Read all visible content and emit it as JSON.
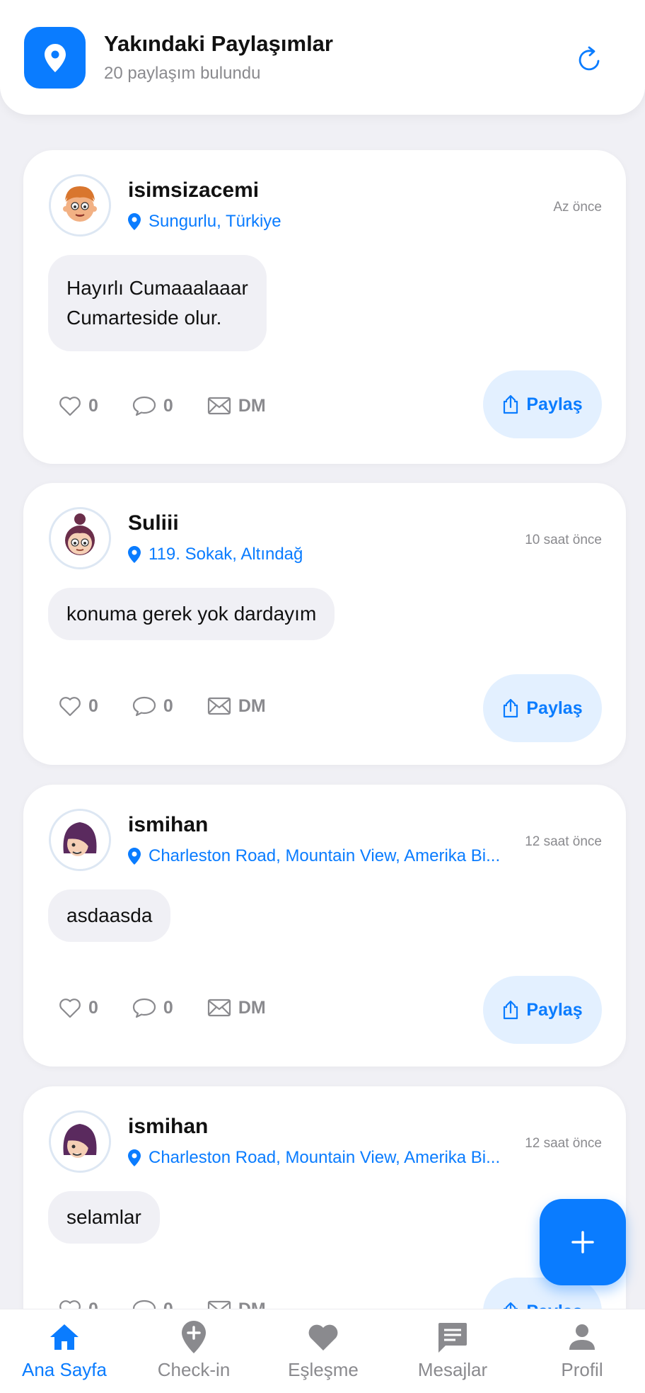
{
  "header": {
    "title": "Yakındaki Paylaşımlar",
    "subtitle": "20 paylaşım bulundu"
  },
  "colors": {
    "accent": "#0a7cff",
    "muted": "#8a8a8e",
    "bubble": "#f0f0f5",
    "share_bg": "#e3f0ff"
  },
  "posts": [
    {
      "username": "isimsizacemi",
      "location": "Sungurlu, Türkiye",
      "time": "Az önce",
      "text": "Hayırlı Cumaaalaaar\nCumarteside olur.",
      "likes": "0",
      "comments": "0",
      "dm": "DM",
      "share": "Paylaş",
      "avatar": "boy-avatar"
    },
    {
      "username": "Suliii",
      "location": "119. Sokak, Altındağ",
      "time": "10 saat önce",
      "text": "konuma gerek yok dardayım",
      "likes": "0",
      "comments": "0",
      "dm": "DM",
      "share": "Paylaş",
      "avatar": "girl-bun-avatar"
    },
    {
      "username": "ismihan",
      "location": "Charleston Road, Mountain View, Amerika Bi...",
      "time": "12 saat önce",
      "text": "asdaasda",
      "likes": "0",
      "comments": "0",
      "dm": "DM",
      "share": "Paylaş",
      "avatar": "girl-purple-avatar"
    },
    {
      "username": "ismihan",
      "location": "Charleston Road, Mountain View, Amerika Bi...",
      "time": "12 saat önce",
      "text": "selamlar",
      "likes": "0",
      "comments": "0",
      "dm": "DM",
      "share": "Paylaş",
      "avatar": "girl-purple-avatar"
    }
  ],
  "fab": {
    "icon": "plus-icon"
  },
  "nav": [
    {
      "label": "Ana Sayfa",
      "icon": "home-icon",
      "active": true
    },
    {
      "label": "Check-in",
      "icon": "location-add-icon",
      "active": false
    },
    {
      "label": "Eşleşme",
      "icon": "heart-icon",
      "active": false
    },
    {
      "label": "Mesajlar",
      "icon": "message-icon",
      "active": false
    },
    {
      "label": "Profil",
      "icon": "person-icon",
      "active": false
    }
  ]
}
